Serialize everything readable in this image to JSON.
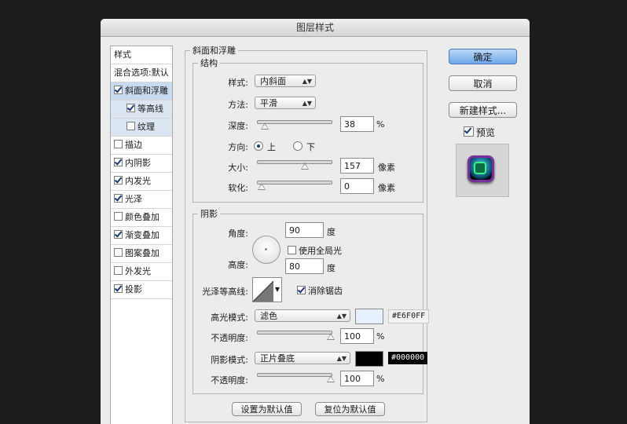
{
  "dialog": {
    "title": "图层样式"
  },
  "styles_panel": {
    "items": [
      {
        "label": "样式",
        "checked": null
      },
      {
        "label": "混合选项:默认",
        "checked": null
      },
      {
        "label": "斜面和浮雕",
        "checked": true
      },
      {
        "label": "等高线",
        "checked": true
      },
      {
        "label": "纹理",
        "checked": false
      },
      {
        "label": "描边",
        "checked": false
      },
      {
        "label": "内阴影",
        "checked": true
      },
      {
        "label": "内发光",
        "checked": true
      },
      {
        "label": "光泽",
        "checked": true
      },
      {
        "label": "颜色叠加",
        "checked": false
      },
      {
        "label": "渐变叠加",
        "checked": true
      },
      {
        "label": "图案叠加",
        "checked": false
      },
      {
        "label": "外发光",
        "checked": false
      },
      {
        "label": "投影",
        "checked": true
      }
    ]
  },
  "bevel": {
    "section_title": "斜面和浮雕",
    "structure_title": "结构",
    "style_label": "样式:",
    "style_value": "内斜面",
    "technique_label": "方法:",
    "technique_value": "平滑",
    "depth_label": "深度:",
    "depth_value": "38",
    "depth_unit": "%",
    "depth_slider": 0.04,
    "direction_label": "方向:",
    "dir_up": "上",
    "dir_down": "下",
    "direction_selected": "上",
    "size_label": "大小:",
    "size_value": "157",
    "size_unit": "像素",
    "size_slider": 0.63,
    "soften_label": "软化:",
    "soften_value": "0",
    "soften_unit": "像素",
    "soften_slider": 0.0
  },
  "shading": {
    "title": "阴影",
    "angle_label": "角度:",
    "angle_value": "90",
    "angle_unit": "度",
    "global_light_label": "使用全局光",
    "global_light_checked": false,
    "altitude_label": "高度:",
    "altitude_value": "80",
    "altitude_unit": "度",
    "gloss_label": "光泽等高线:",
    "antialias_label": "消除锯齿",
    "antialias_checked": true,
    "highlight_mode_label": "高光模式:",
    "highlight_mode_value": "滤色",
    "highlight_color": "#E6F0FF",
    "highlight_hex": "#E6F0FF",
    "highlight_opacity_label": "不透明度:",
    "highlight_opacity_value": "100",
    "highlight_opacity_unit": "%",
    "shadow_mode_label": "阴影模式:",
    "shadow_mode_value": "正片叠底",
    "shadow_color": "#000000",
    "shadow_hex": "#000000",
    "shadow_opacity_label": "不透明度:",
    "shadow_opacity_value": "100",
    "shadow_opacity_unit": "%"
  },
  "footer": {
    "make_default": "设置为默认值",
    "reset_default": "复位为默认值"
  },
  "actions": {
    "ok": "确定",
    "cancel": "取消",
    "new_style": "新建样式...",
    "preview_label": "预览",
    "preview_checked": true
  }
}
